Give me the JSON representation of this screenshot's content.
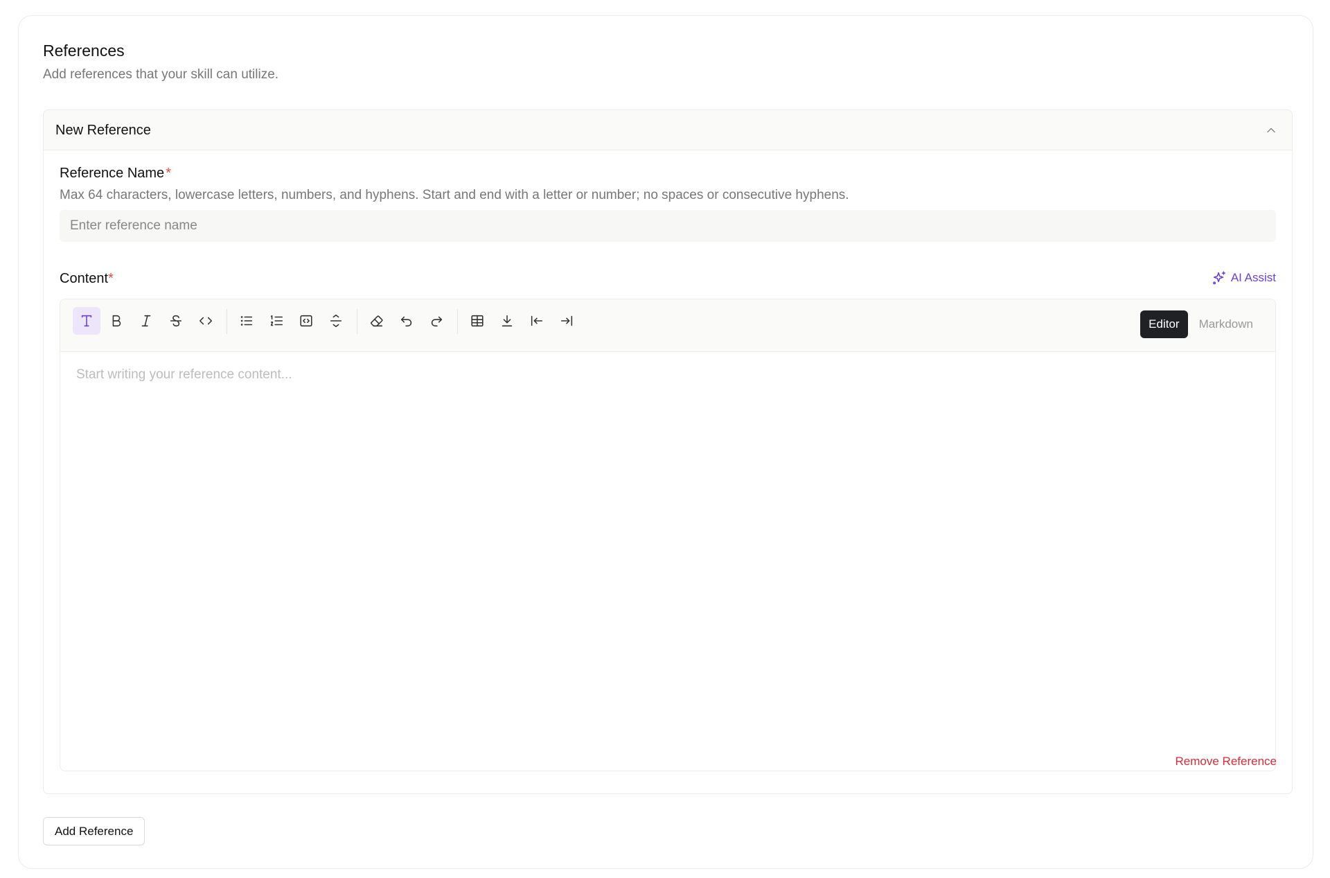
{
  "section": {
    "title": "References",
    "subtitle": "Add references that your skill can utilize."
  },
  "reference": {
    "header_title": "New Reference",
    "name_field": {
      "label": "Reference Name",
      "required_mark": "*",
      "help": "Max 64 characters, lowercase letters, numbers, and hyphens. Start and end with a letter or number; no spaces or consecutive hyphens.",
      "placeholder": "Enter reference name",
      "value": ""
    },
    "content_field": {
      "label": "Content",
      "required_mark": "*",
      "placeholder": "Start writing your reference content..."
    },
    "ai_assist_label": "AI Assist",
    "toolbar": {
      "buttons": [
        "text-icon",
        "bold-icon",
        "italic-icon",
        "strikethrough-icon",
        "code-icon",
        "bullet-list-icon",
        "ordered-list-icon",
        "code-block-icon",
        "horizontal-rule-icon",
        "eraser-icon",
        "undo-icon",
        "redo-icon",
        "table-icon",
        "download-icon",
        "outdent-icon",
        "indent-icon"
      ],
      "modes": [
        "Editor",
        "Markdown"
      ],
      "active_mode": "Editor"
    },
    "remove_label": "Remove Reference"
  },
  "add_reference_label": "Add Reference",
  "colors": {
    "accent": "#6d3fd8",
    "danger": "#d72b3a",
    "active_mode_bg": "#1f2125"
  }
}
